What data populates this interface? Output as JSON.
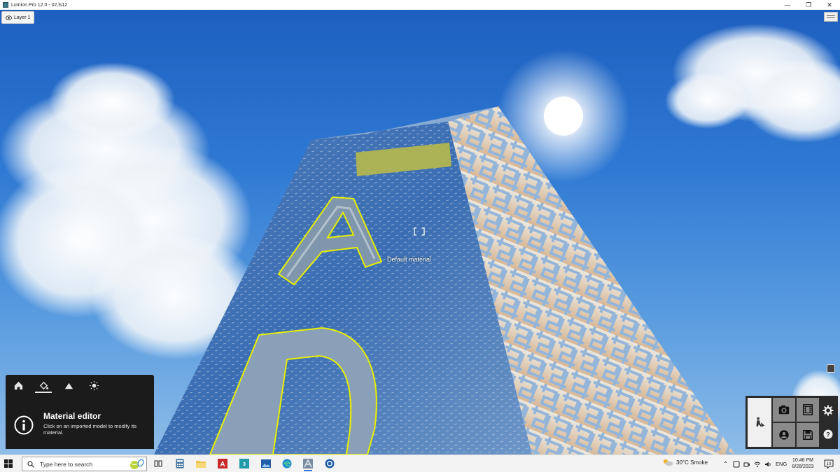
{
  "window": {
    "title": "Lumion Pro 12.0  - 02.ls12",
    "minimize_icon": "minimize-icon",
    "restore_icon": "restore-icon",
    "close_icon": "close-icon"
  },
  "viewport": {
    "layer_button_label": "Layer 1",
    "hover_label": "Default material"
  },
  "mode_bar": {
    "items": [
      "home-icon",
      "material-paint-icon",
      "landscape-icon",
      "sun-icon"
    ],
    "active": "material-paint-icon"
  },
  "info_panel": {
    "title": "Material editor",
    "text": "Click on an imported model to modify its material."
  },
  "output_panel": {
    "items": [
      "build-mode-icon",
      "photo-camera-icon",
      "movie-film-icon",
      "panorama-360-icon",
      "save-disk-icon",
      "settings-gear-icon",
      "help-icon"
    ]
  },
  "taskbar": {
    "search_placeholder": "Type here to search",
    "pinned_apps": [
      "task-view-icon",
      "calculator-icon",
      "file-explorer-icon",
      "autocad-icon",
      "3ds-max-icon",
      "photos-icon",
      "edge-icon",
      "lumion-icon",
      "sketchup-icon"
    ],
    "weather": "30°C  Smoke",
    "language": "ENG",
    "time": "10:46 PM",
    "date": "8/28/2023"
  },
  "colors": {
    "panel_bg": "#1b1b1b",
    "selection_outline": "#e8f000",
    "taskbar_bg": "#f3f3f3",
    "accent": "#3a78d6"
  }
}
